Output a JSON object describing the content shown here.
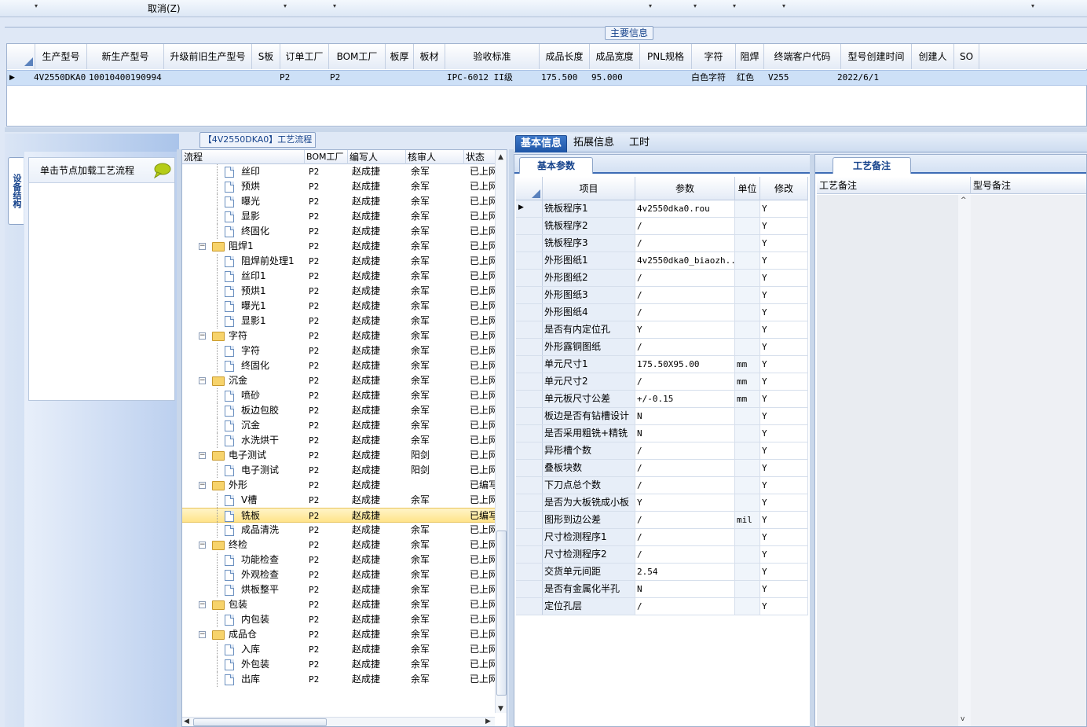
{
  "toolbar": {
    "cancel_label": "取消(Z)",
    "dropdown_arrow": "▾"
  },
  "main_info": {
    "title": "主要信息",
    "columns": [
      "生产型号",
      "新生产型号",
      "升级前旧生产型号",
      "S板",
      "订单工厂",
      "BOM工厂",
      "板厚",
      "板材",
      "验收标准",
      "成品长度",
      "成品宽度",
      "PNL规格",
      "字符",
      "阻焊",
      "终端客户代码",
      "型号创建时间",
      "创建人",
      "SO"
    ],
    "row": {
      "生产型号": "4V2550DKA0",
      "新生产型号": "10010400190994",
      "升级前旧生产型号": "",
      "S板": "",
      "订单工厂": "P2",
      "BOM工厂": "P2",
      "板厚": "",
      "板材": "",
      "验收标准": "IPC-6012 II级",
      "成品长度": "175.500",
      "成品宽度": "95.000",
      "PNL规格": "",
      "字符": "白色字符",
      "阻焊": "红色",
      "终端客户代码": "V255",
      "型号创建时间": "2022/6/1",
      "创建人": "",
      "SO": ""
    }
  },
  "left_panel": {
    "vertical_tab": "设备结构",
    "hint_text": "单击节点加载工艺流程"
  },
  "process_tree": {
    "title": "【4V2550DKA0】工艺流程",
    "columns": [
      "流程",
      "BOM工厂",
      "编写人",
      "核审人",
      "状态"
    ],
    "rows": [
      {
        "name": "丝印",
        "folder": false,
        "bom": "P2",
        "writer": "赵成捷",
        "reviewer": "余军",
        "status": "已上网"
      },
      {
        "name": "预烘",
        "folder": false,
        "bom": "P2",
        "writer": "赵成捷",
        "reviewer": "余军",
        "status": "已上网"
      },
      {
        "name": "曝光",
        "folder": false,
        "bom": "P2",
        "writer": "赵成捷",
        "reviewer": "余军",
        "status": "已上网"
      },
      {
        "name": "显影",
        "folder": false,
        "bom": "P2",
        "writer": "赵成捷",
        "reviewer": "余军",
        "status": "已上网"
      },
      {
        "name": "终固化",
        "folder": false,
        "bom": "P2",
        "writer": "赵成捷",
        "reviewer": "余军",
        "status": "已上网"
      },
      {
        "name": "阻焊1",
        "folder": true,
        "bom": "P2",
        "writer": "赵成捷",
        "reviewer": "余军",
        "status": "已上网"
      },
      {
        "name": "阻焊前处理1",
        "folder": false,
        "bom": "P2",
        "writer": "赵成捷",
        "reviewer": "余军",
        "status": "已上网"
      },
      {
        "name": "丝印1",
        "folder": false,
        "bom": "P2",
        "writer": "赵成捷",
        "reviewer": "余军",
        "status": "已上网"
      },
      {
        "name": "预烘1",
        "folder": false,
        "bom": "P2",
        "writer": "赵成捷",
        "reviewer": "余军",
        "status": "已上网"
      },
      {
        "name": "曝光1",
        "folder": false,
        "bom": "P2",
        "writer": "赵成捷",
        "reviewer": "余军",
        "status": "已上网"
      },
      {
        "name": "显影1",
        "folder": false,
        "bom": "P2",
        "writer": "赵成捷",
        "reviewer": "余军",
        "status": "已上网"
      },
      {
        "name": "字符",
        "folder": true,
        "bom": "P2",
        "writer": "赵成捷",
        "reviewer": "余军",
        "status": "已上网"
      },
      {
        "name": "字符",
        "folder": false,
        "bom": "P2",
        "writer": "赵成捷",
        "reviewer": "余军",
        "status": "已上网"
      },
      {
        "name": "终固化",
        "folder": false,
        "bom": "P2",
        "writer": "赵成捷",
        "reviewer": "余军",
        "status": "已上网"
      },
      {
        "name": "沉金",
        "folder": true,
        "bom": "P2",
        "writer": "赵成捷",
        "reviewer": "余军",
        "status": "已上网"
      },
      {
        "name": "喷砂",
        "folder": false,
        "bom": "P2",
        "writer": "赵成捷",
        "reviewer": "余军",
        "status": "已上网"
      },
      {
        "name": "板边包胶",
        "folder": false,
        "bom": "P2",
        "writer": "赵成捷",
        "reviewer": "余军",
        "status": "已上网"
      },
      {
        "name": "沉金",
        "folder": false,
        "bom": "P2",
        "writer": "赵成捷",
        "reviewer": "余军",
        "status": "已上网"
      },
      {
        "name": "水洗烘干",
        "folder": false,
        "bom": "P2",
        "writer": "赵成捷",
        "reviewer": "余军",
        "status": "已上网"
      },
      {
        "name": "电子测试",
        "folder": true,
        "bom": "P2",
        "writer": "赵成捷",
        "reviewer": "阳剑",
        "status": "已上网"
      },
      {
        "name": "电子测试",
        "folder": false,
        "bom": "P2",
        "writer": "赵成捷",
        "reviewer": "阳剑",
        "status": "已上网"
      },
      {
        "name": "外形",
        "folder": true,
        "bom": "P2",
        "writer": "赵成捷",
        "reviewer": "",
        "status": "已编写"
      },
      {
        "name": "V槽",
        "folder": false,
        "bom": "P2",
        "writer": "赵成捷",
        "reviewer": "余军",
        "status": "已上网"
      },
      {
        "name": "铣板",
        "folder": false,
        "bom": "P2",
        "writer": "赵成捷",
        "reviewer": "",
        "status": "已编写",
        "selected": true
      },
      {
        "name": "成品清洗",
        "folder": false,
        "bom": "P2",
        "writer": "赵成捷",
        "reviewer": "余军",
        "status": "已上网"
      },
      {
        "name": "终检",
        "folder": true,
        "bom": "P2",
        "writer": "赵成捷",
        "reviewer": "余军",
        "status": "已上网"
      },
      {
        "name": "功能检查",
        "folder": false,
        "bom": "P2",
        "writer": "赵成捷",
        "reviewer": "余军",
        "status": "已上网"
      },
      {
        "name": "外观检查",
        "folder": false,
        "bom": "P2",
        "writer": "赵成捷",
        "reviewer": "余军",
        "status": "已上网"
      },
      {
        "name": "烘板整平",
        "folder": false,
        "bom": "P2",
        "writer": "赵成捷",
        "reviewer": "余军",
        "status": "已上网"
      },
      {
        "name": "包装",
        "folder": true,
        "bom": "P2",
        "writer": "赵成捷",
        "reviewer": "余军",
        "status": "已上网"
      },
      {
        "name": "内包装",
        "folder": false,
        "bom": "P2",
        "writer": "赵成捷",
        "reviewer": "余军",
        "status": "已上网"
      },
      {
        "name": "成品仓",
        "folder": true,
        "bom": "P2",
        "writer": "赵成捷",
        "reviewer": "余军",
        "status": "已上网"
      },
      {
        "name": "入库",
        "folder": false,
        "bom": "P2",
        "writer": "赵成捷",
        "reviewer": "余军",
        "status": "已上网"
      },
      {
        "name": "外包装",
        "folder": false,
        "bom": "P2",
        "writer": "赵成捷",
        "reviewer": "余军",
        "status": "已上网"
      },
      {
        "name": "出库",
        "folder": false,
        "bom": "P2",
        "writer": "赵成捷",
        "reviewer": "余军",
        "status": "已上网"
      }
    ]
  },
  "right_tabs": [
    "基本信息",
    "拓展信息",
    "工时"
  ],
  "basic_params": {
    "tab_label": "基本参数",
    "columns": [
      "项目",
      "参数",
      "单位",
      "修改"
    ],
    "rows": [
      {
        "item": "铣板程序1",
        "param": "4v2550dka0.rou",
        "unit": "",
        "mod": "Y"
      },
      {
        "item": "铣板程序2",
        "param": "/",
        "unit": "",
        "mod": "Y"
      },
      {
        "item": "铣板程序3",
        "param": "/",
        "unit": "",
        "mod": "Y"
      },
      {
        "item": "外形图纸1",
        "param": "4v2550dka0_biaozh...",
        "unit": "",
        "mod": "Y"
      },
      {
        "item": "外形图纸2",
        "param": "/",
        "unit": "",
        "mod": "Y"
      },
      {
        "item": "外形图纸3",
        "param": "/",
        "unit": "",
        "mod": "Y"
      },
      {
        "item": "外形图纸4",
        "param": "/",
        "unit": "",
        "mod": "Y"
      },
      {
        "item": "是否有内定位孔",
        "param": "Y",
        "unit": "",
        "mod": "Y"
      },
      {
        "item": "外形露铜图纸",
        "param": "/",
        "unit": "",
        "mod": "Y"
      },
      {
        "item": "单元尺寸1",
        "param": "175.50X95.00",
        "unit": "mm",
        "mod": "Y"
      },
      {
        "item": "单元尺寸2",
        "param": "/",
        "unit": "mm",
        "mod": "Y"
      },
      {
        "item": "单元板尺寸公差",
        "param": "+/-0.15",
        "unit": "mm",
        "mod": "Y"
      },
      {
        "item": "板边是否有钻槽设计",
        "param": "N",
        "unit": "",
        "mod": "Y"
      },
      {
        "item": "是否采用粗铣+精铣",
        "param": "N",
        "unit": "",
        "mod": "Y"
      },
      {
        "item": "异形槽个数",
        "param": "/",
        "unit": "",
        "mod": "Y"
      },
      {
        "item": "叠板块数",
        "param": "/",
        "unit": "",
        "mod": "Y"
      },
      {
        "item": "下刀点总个数",
        "param": "/",
        "unit": "",
        "mod": "Y"
      },
      {
        "item": "是否为大板铣成小板",
        "param": "Y",
        "unit": "",
        "mod": "Y"
      },
      {
        "item": "图形到边公差",
        "param": "/",
        "unit": "mil",
        "mod": "Y"
      },
      {
        "item": "尺寸检测程序1",
        "param": "/",
        "unit": "",
        "mod": "Y"
      },
      {
        "item": "尺寸检测程序2",
        "param": "/",
        "unit": "",
        "mod": "Y"
      },
      {
        "item": "交货单元间距",
        "param": "2.54",
        "unit": "",
        "mod": "Y"
      },
      {
        "item": "是否有金属化半孔",
        "param": "N",
        "unit": "",
        "mod": "Y"
      },
      {
        "item": "定位孔层",
        "param": "/",
        "unit": "",
        "mod": "Y"
      }
    ]
  },
  "remarks": {
    "tab_label": "工艺备注",
    "columns": [
      "工艺备注",
      "型号备注"
    ]
  },
  "colors": {
    "accent": "#1f56a7",
    "selection": "#cde0f7",
    "tree_selected": "#ffe48a"
  }
}
